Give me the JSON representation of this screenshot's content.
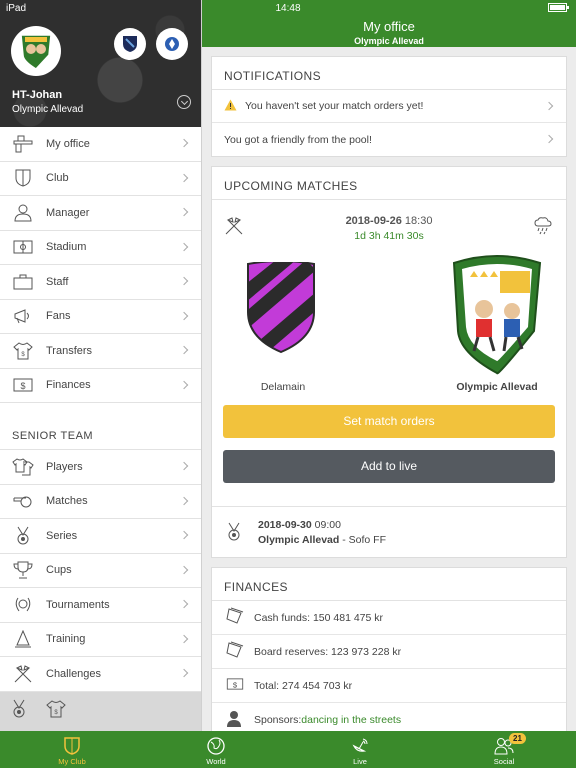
{
  "status_bar": {
    "device": "iPad",
    "time": "14:48",
    "battery": "▮▮▮"
  },
  "sidebar": {
    "user_name": "HT-Johan",
    "club_name": "Olympic Allevad",
    "menu": [
      {
        "label": "My office",
        "icon": "desk-icon"
      },
      {
        "label": "Club",
        "icon": "shield-icon"
      },
      {
        "label": "Manager",
        "icon": "person-icon"
      },
      {
        "label": "Stadium",
        "icon": "stadium-icon"
      },
      {
        "label": "Staff",
        "icon": "briefcase-icon"
      },
      {
        "label": "Fans",
        "icon": "megaphone-icon"
      },
      {
        "label": "Transfers",
        "icon": "shirt-icon"
      },
      {
        "label": "Finances",
        "icon": "money-icon"
      }
    ],
    "senior_team_title": "SENIOR TEAM",
    "senior_menu": [
      {
        "label": "Players",
        "icon": "shirts-icon"
      },
      {
        "label": "Matches",
        "icon": "whistle-icon"
      },
      {
        "label": "Series",
        "icon": "medal-icon"
      },
      {
        "label": "Cups",
        "icon": "trophy-icon"
      },
      {
        "label": "Tournaments",
        "icon": "laurel-icon"
      },
      {
        "label": "Training",
        "icon": "cone-icon"
      },
      {
        "label": "Challenges",
        "icon": "crossed-flags-icon"
      }
    ]
  },
  "header": {
    "title": "My office",
    "subtitle": "Olympic Allevad"
  },
  "notifications": {
    "title": "NOTIFICATIONS",
    "items": [
      "You haven't set your match orders yet!",
      "You got a friendly from the pool!"
    ]
  },
  "upcoming": {
    "title": "UPCOMING MATCHES",
    "date": "2018-09-26",
    "time": "18:30",
    "countdown": "1d 3h 41m 30s",
    "home_team": "Delamain",
    "away_team": "Olympic Allevad",
    "set_orders_label": "Set match orders",
    "add_live_label": "Add to live",
    "next_date": "2018-09-30",
    "next_time": "09:00",
    "next_home": "Olympic Allevad",
    "next_sep": " - ",
    "next_away": "Sofo FF"
  },
  "finances": {
    "title": "FINANCES",
    "cash": "Cash funds: 150 481 475 kr",
    "board": "Board reserves: 123 973 228 kr",
    "total": "Total: 274 454 703 kr",
    "sponsors_label": "Sponsors: ",
    "sponsors_value": "dancing in the streets"
  },
  "tabbar": {
    "tabs": [
      {
        "label": "My Club"
      },
      {
        "label": "World"
      },
      {
        "label": "Live"
      },
      {
        "label": "Social",
        "badge": "21"
      }
    ]
  },
  "colors": {
    "green": "#3a8a2b",
    "yellow": "#f2c23c",
    "dark_button": "#555a60"
  }
}
